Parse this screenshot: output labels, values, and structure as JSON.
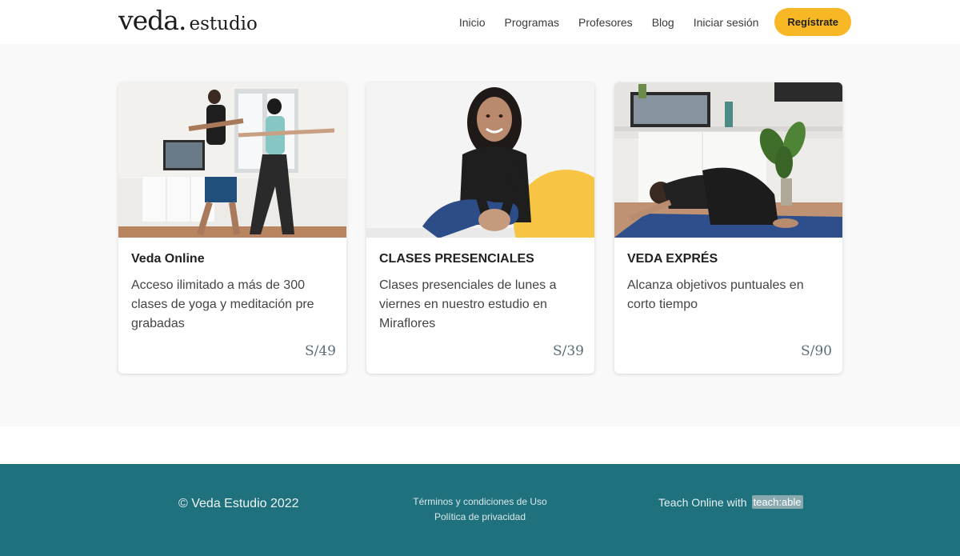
{
  "header": {
    "logo_main": "veda.",
    "logo_sub": "estudio",
    "nav": [
      {
        "label": "Inicio"
      },
      {
        "label": "Programas"
      },
      {
        "label": "Profesores"
      },
      {
        "label": "Blog"
      },
      {
        "label": "Iniciar sesión"
      }
    ],
    "signup_label": "Regístrate"
  },
  "cards": [
    {
      "title": "Veda Online",
      "description": "Acceso ilimitado a más de 300 clases de yoga y meditación pre grabadas",
      "price": "S/49"
    },
    {
      "title": "CLASES PRESENCIALES",
      "description": "Clases presenciales de lunes a viernes en nuestro estudio en Miraflores",
      "price": "S/39"
    },
    {
      "title": "VEDA EXPRÉS",
      "description": "Alcanza objetivos puntuales en corto tiempo",
      "price": "S/90"
    }
  ],
  "footer": {
    "copyright": "© Veda Estudio 2022",
    "terms": "Términos y condiciones de Uso",
    "privacy": "Política de privacidad",
    "teach_prefix": "Teach Online with",
    "teach_brand": "teach:able"
  },
  "colors": {
    "accent": "#f8b825",
    "footer_bg": "#1f717e",
    "price": "#5b6e78"
  }
}
